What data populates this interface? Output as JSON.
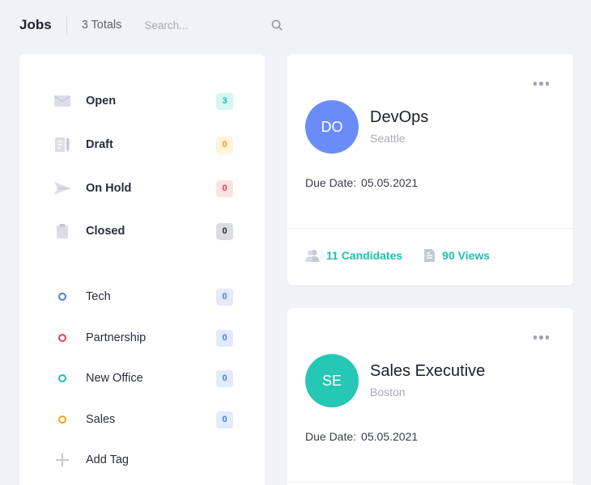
{
  "header": {
    "title": "Jobs",
    "totals": "3 Totals",
    "search_placeholder": "Search..."
  },
  "sidebar": {
    "statuses": [
      {
        "label": "Open",
        "count": "3",
        "icon": "envelope-icon"
      },
      {
        "label": "Draft",
        "count": "0",
        "icon": "draft-icon"
      },
      {
        "label": "On Hold",
        "count": "0",
        "icon": "paper-plane-icon"
      },
      {
        "label": "Closed",
        "count": "0",
        "icon": "clipboard-icon"
      }
    ],
    "tags": [
      {
        "label": "Tech",
        "count": "0",
        "color": "#4a7de3"
      },
      {
        "label": "Partnership",
        "count": "0",
        "color": "#ea3a52"
      },
      {
        "label": "New Office",
        "count": "0",
        "color": "#1fbfad"
      },
      {
        "label": "Sales",
        "count": "0",
        "color": "#f4a11c"
      }
    ],
    "add_tag_label": "Add Tag"
  },
  "jobs": [
    {
      "initials": "DO",
      "title": "DevOps",
      "location": "Seattle",
      "due_label": "Due Date:",
      "due_date": "05.05.2021",
      "candidates": "11 Candidates",
      "views": "90 Views",
      "avatar_color": "#6a8cf8"
    },
    {
      "initials": "SE",
      "title": "Sales Executive",
      "location": "Boston",
      "due_label": "Due Date:",
      "due_date": "05.05.2021",
      "avatar_color": "#26c7b4"
    }
  ],
  "colors": {
    "accent_teal": "#1fbfad",
    "badge_open_bg": "#d5f6f1",
    "badge_draft_bg": "#fff3da",
    "badge_hold_bg": "#fde2e4",
    "badge_closed_bg": "#dcdde3",
    "badge_tag_bg": "#e3eafc"
  }
}
